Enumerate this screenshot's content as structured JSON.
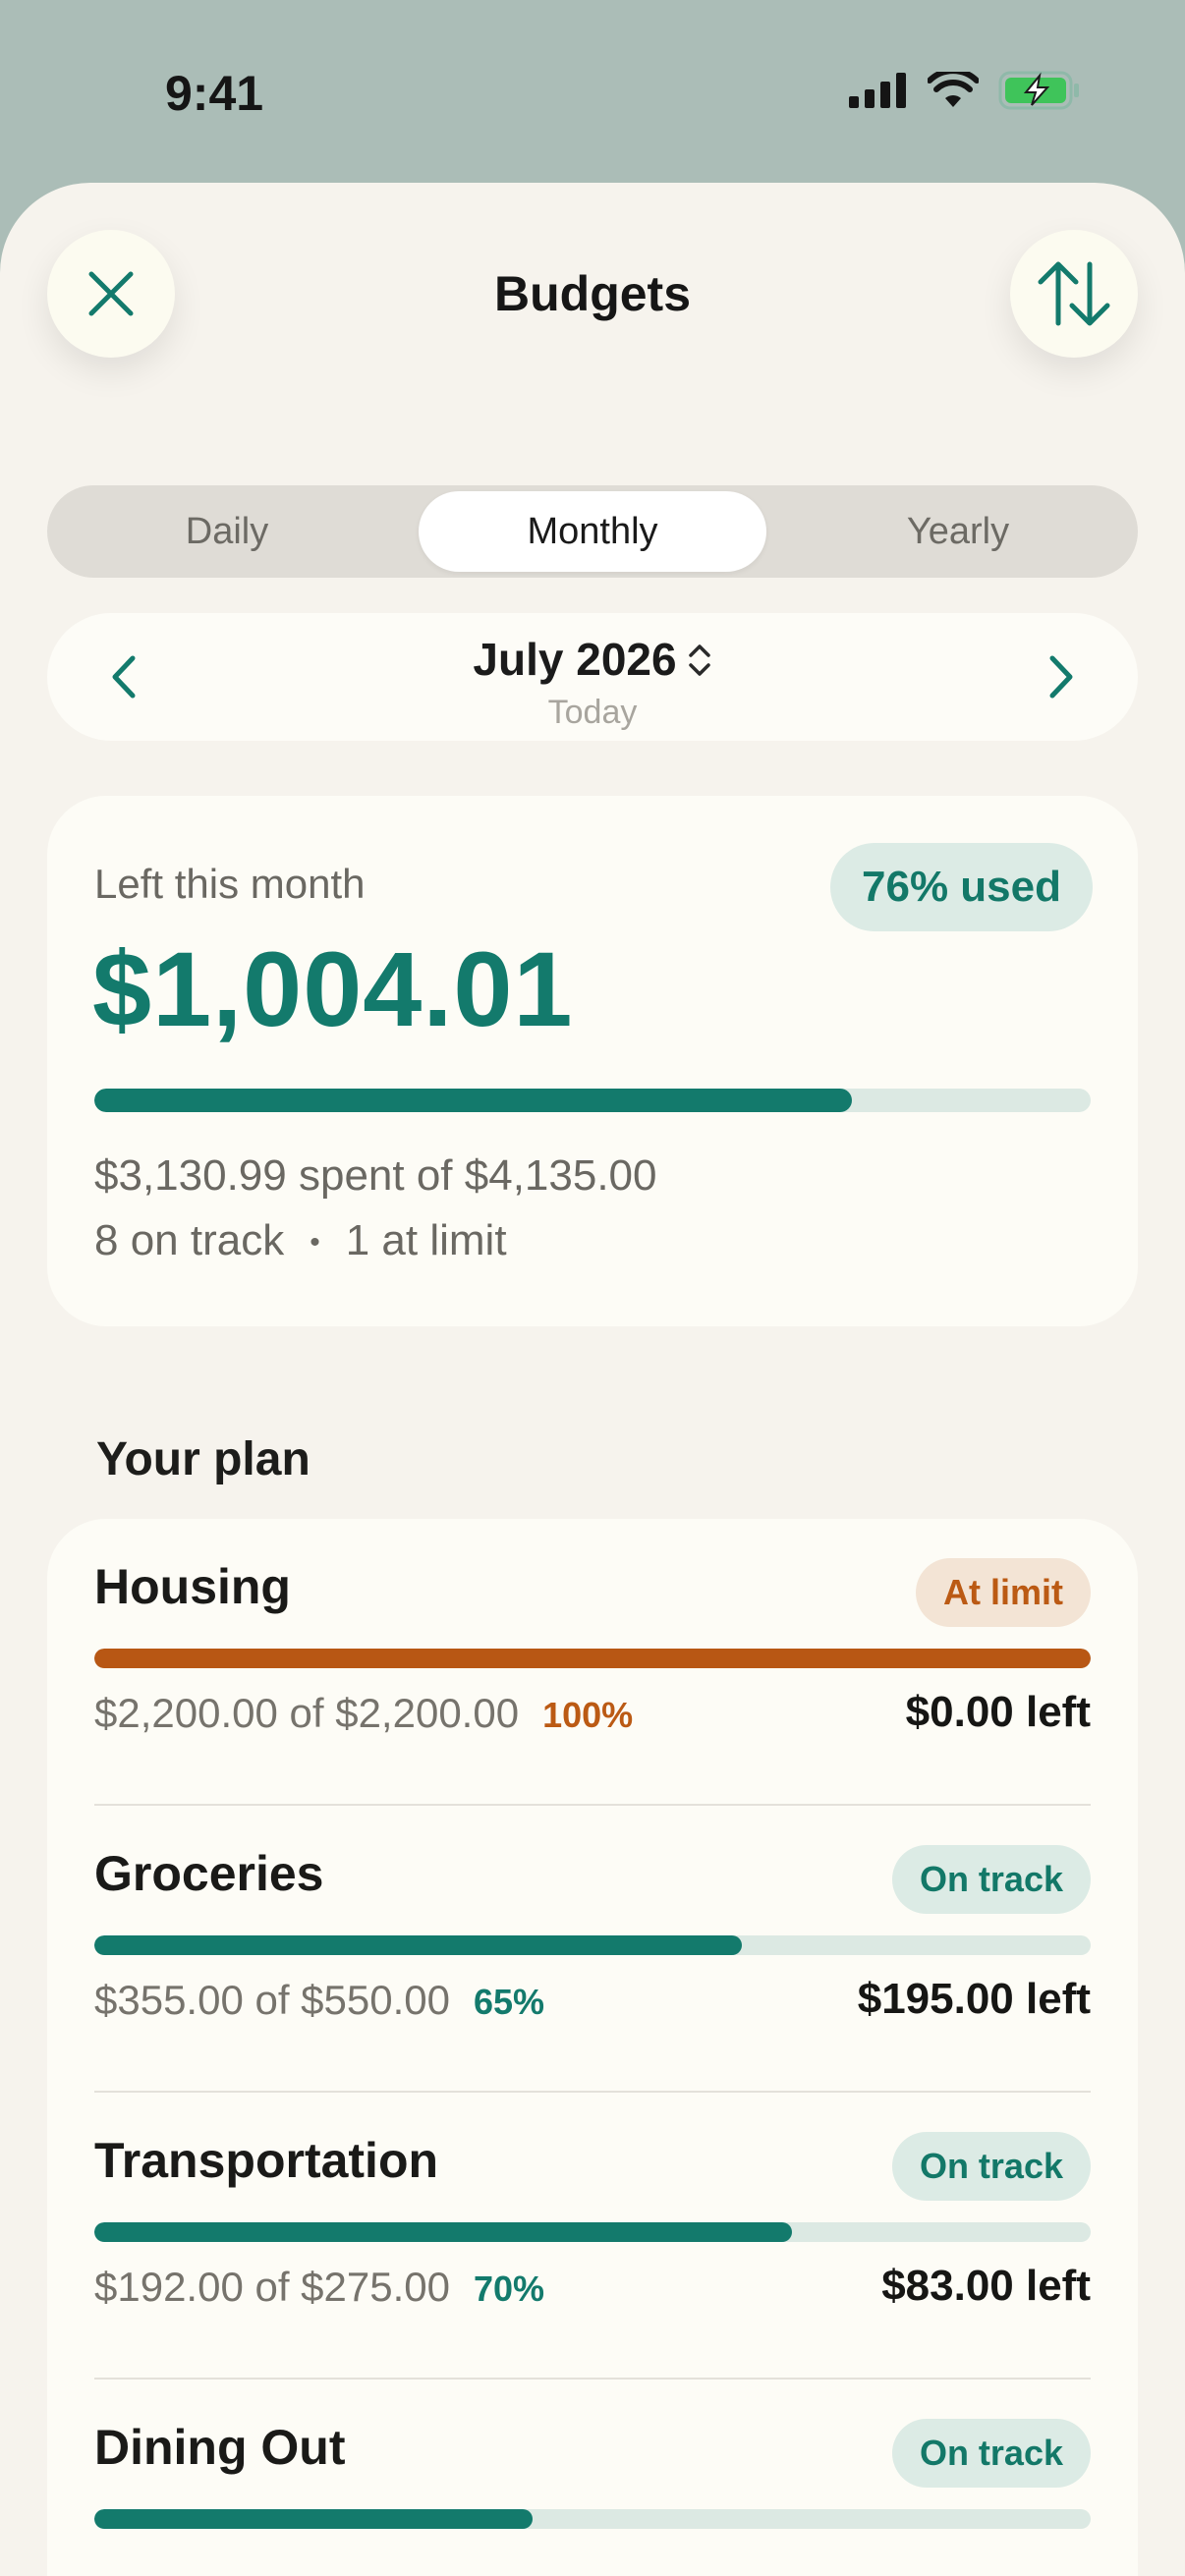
{
  "status_bar": {
    "time": "9:41"
  },
  "header": {
    "title": "Budgets"
  },
  "tabs": [
    {
      "label": "Daily",
      "active": false
    },
    {
      "label": "Monthly",
      "active": true
    },
    {
      "label": "Yearly",
      "active": false
    }
  ],
  "period": {
    "title": "July 2026",
    "subtitle": "Today"
  },
  "summary": {
    "label": "Left this month",
    "used_badge": "76% used",
    "amount": "$1,004.01",
    "progress_percent": 76,
    "spent_text": "$3,130.99 spent of $4,135.00",
    "on_track": "8 on track",
    "separator": "•",
    "at_limit": "1 at limit"
  },
  "plan": {
    "heading": "Your plan",
    "items": [
      {
        "name": "Housing",
        "badge": "At limit",
        "status": "limit",
        "amounts": "$2,200.00 of $2,200.00",
        "percent": "100%",
        "progress": 100,
        "left": "$0.00 left"
      },
      {
        "name": "Groceries",
        "badge": "On track",
        "status": "track",
        "amounts": "$355.00 of $550.00",
        "percent": "65%",
        "progress": 65,
        "left": "$195.00 left"
      },
      {
        "name": "Transportation",
        "badge": "On track",
        "status": "track",
        "amounts": "$192.00 of $275.00",
        "percent": "70%",
        "progress": 70,
        "left": "$83.00 left"
      },
      {
        "name": "Dining Out",
        "badge": "On track",
        "status": "track",
        "progress": 44
      }
    ]
  },
  "colors": {
    "accent": "#137a6c",
    "warning": "#b85714",
    "track_bg": "#dce9e3"
  },
  "icons": {
    "close": "close-icon",
    "sort": "sort-icon",
    "prev": "chevron-left-icon",
    "next": "chevron-right-icon",
    "period_picker": "chevron-up-down-icon"
  }
}
